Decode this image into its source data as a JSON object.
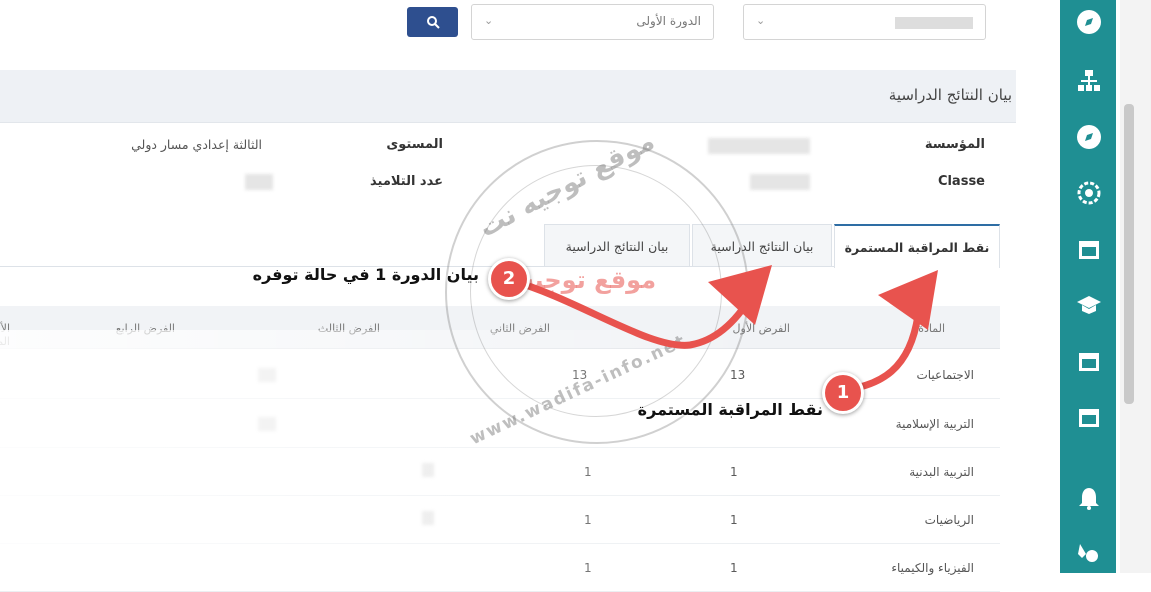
{
  "filters": {
    "session_value": "الدورة الأولى",
    "search_icon": "search-icon"
  },
  "section": {
    "title": "بيان النتائج الدراسية"
  },
  "info": {
    "institution_label": "المؤسسة",
    "class_label": "Classe",
    "level_label": "المستوى",
    "level_value": "الثالثة إعدادي مسار دولي",
    "students_count_label": "عدد التلاميذ"
  },
  "tabs": [
    {
      "label": "نقط المراقبة المستمرة"
    },
    {
      "label": "بيان النتائج الدراسية"
    },
    {
      "label": "بيان النتائج الدراسية"
    }
  ],
  "table": {
    "headers": [
      "المادة",
      "الفرض الأول",
      "الفرض الثاني",
      "الفرض الثالث",
      "الفرض الرابع",
      "الأنشطة المندمجة"
    ],
    "rows": [
      {
        "subject": "الاجتماعيات",
        "v1": "13",
        "v2": "13"
      },
      {
        "subject": "التربية الإسلامية",
        "v1": "",
        "v2": ""
      },
      {
        "subject": "التربية البدنية",
        "v1": "1",
        "v2": "1"
      },
      {
        "subject": "الرياضيات",
        "v1": "1",
        "v2": "1"
      },
      {
        "subject": "الفيزياء والكيمياء",
        "v1": "1",
        "v2": "1"
      }
    ]
  },
  "annotations": {
    "step1_number": "1",
    "step1_text": "نقط المراقبة المستمرة",
    "step2_number": "2",
    "step2_text": "بيان الدورة 1 في حالة توفره"
  },
  "watermark": {
    "top_text": "موقع توجيه نت",
    "center_text": "موقع توجيه",
    "url_text": "www.wadifa-info.net"
  },
  "sidebar": {
    "icons": [
      "compass-icon",
      "network-icon",
      "compass-icon",
      "settings-icon",
      "calendar-icon",
      "graduation-cap-icon",
      "calendar-icon",
      "calendar-icon",
      "bell-icon",
      "medal-icon"
    ]
  },
  "colors": {
    "sidebar": "#1f8f93",
    "search_button": "#2e4f8f",
    "annotation_red": "#e8534e"
  }
}
